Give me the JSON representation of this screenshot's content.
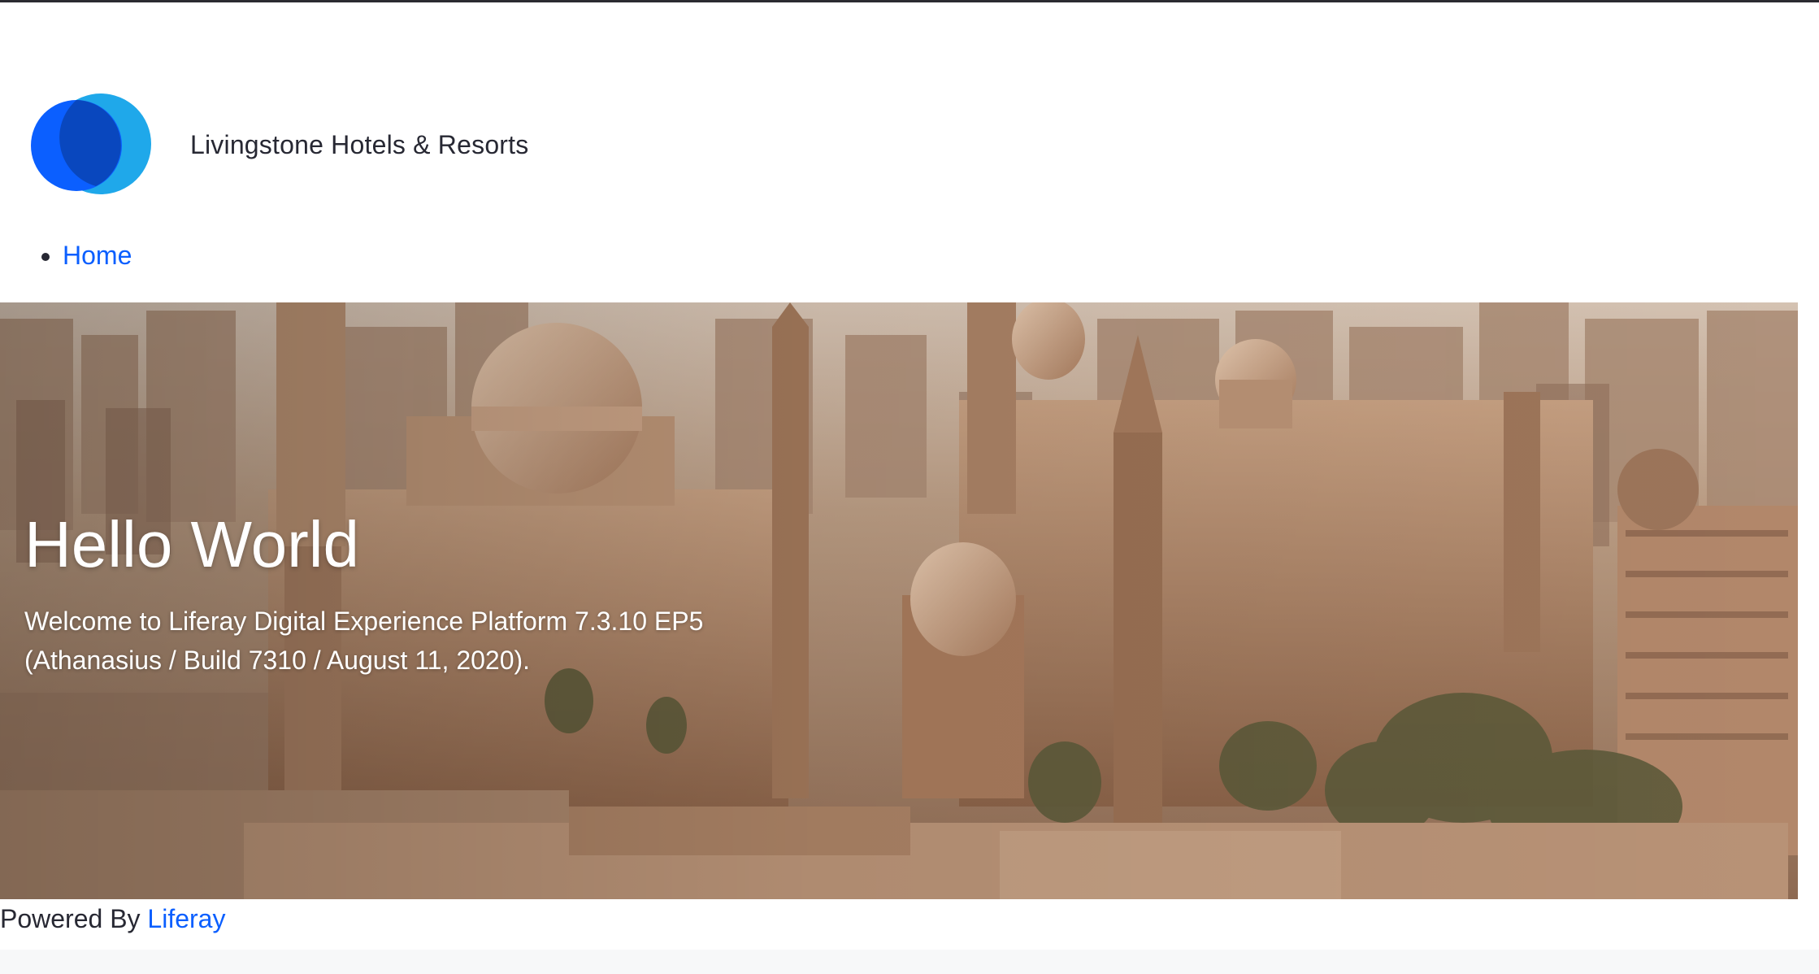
{
  "site": {
    "name": "Livingstone Hotels & Resorts",
    "logo_icon": "liferay-logo-icon"
  },
  "nav": {
    "items": [
      {
        "label": "Home"
      }
    ]
  },
  "hero": {
    "title": "Hello World",
    "text": "Welcome to Liferay Digital Experience Platform 7.3.10 EP5 (Athanasius / Build 7310 / August 11, 2020).",
    "image": "cairo-mosque-cityscape"
  },
  "footer": {
    "prefix": "Powered By",
    "link_label": "Liferay"
  },
  "colors": {
    "link": "#0b5fff",
    "text": "#272833",
    "logo_dark": "#0b5fff",
    "logo_light": "#1fa8ea",
    "logo_overlap": "#0a3fa8"
  }
}
